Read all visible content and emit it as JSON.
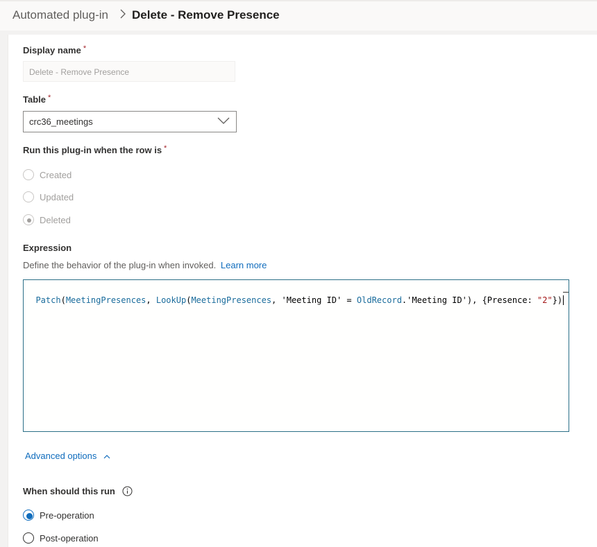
{
  "breadcrumb": {
    "parent": "Automated plug-in",
    "separator": ">",
    "current": "Delete - Remove Presence"
  },
  "form": {
    "display_name_label": "Display name",
    "display_name_placeholder": "Delete - Remove Presence",
    "required_mark": "*",
    "table_label": "Table",
    "table_value": "crc36_meetings",
    "run_label": "Run this plug-in when the row is",
    "run_options": [
      "Created",
      "Updated",
      "Deleted"
    ],
    "run_selected": "Deleted",
    "expression_label": "Expression",
    "expression_help": "Define the behavior of the plug-in when invoked.",
    "learn_more": "Learn more",
    "expression_code": "Patch(MeetingPresences, LookUp(MeetingPresences, 'Meeting ID' = OldRecord.'Meeting ID'), {Presence: \"2\"})",
    "advanced_options": "Advanced options",
    "when_label": "When should this run",
    "when_options": [
      "Pre-operation",
      "Post-operation"
    ],
    "when_selected": "Pre-operation"
  },
  "icons": {
    "breadcrumb_separator": "chevron-right-icon",
    "dropdown": "chevron-down-icon",
    "advanced": "chevron-up-icon",
    "info": "info-icon"
  },
  "colors": {
    "accent": "#0f6cbd",
    "required": "#a4262c",
    "editor_border": "#2b6f87"
  }
}
